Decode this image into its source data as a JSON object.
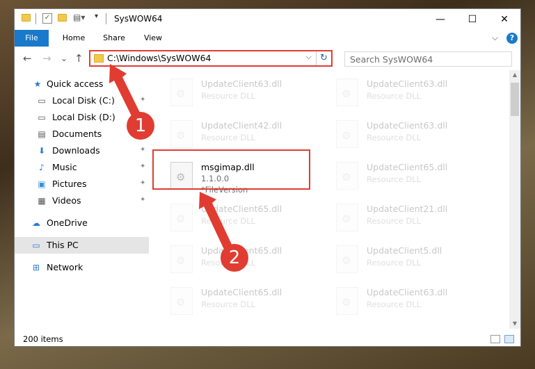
{
  "window": {
    "title": "SysWOW64",
    "minimize": "—",
    "maximize": "☐",
    "close": "✕"
  },
  "ribbon": {
    "tabs": [
      "File",
      "Home",
      "Share",
      "View"
    ],
    "collapse": "⌵",
    "help": "?"
  },
  "address": {
    "path": "C:\\Windows\\SysWOW64",
    "dropdown": "⌵",
    "refresh": "↻"
  },
  "search": {
    "placeholder": "Search SysWOW64"
  },
  "nav": {
    "back": "←",
    "forward": "→",
    "recent": "⌄",
    "up": "↑"
  },
  "sidebar": {
    "items": [
      {
        "label": "Quick access",
        "icon": "star-icon",
        "glyph": "★",
        "color": "#2b7cd3"
      },
      {
        "label": "Local Disk (C:)",
        "icon": "drive-icon",
        "glyph": "▭",
        "color": "#555555",
        "pinned": true
      },
      {
        "label": "Local Disk (D:)",
        "icon": "drive-icon",
        "glyph": "▭",
        "color": "#555555",
        "pinned": false
      },
      {
        "label": "Documents",
        "icon": "documents-icon",
        "glyph": "▤",
        "color": "#555555",
        "pinned": true
      },
      {
        "label": "Downloads",
        "icon": "download-icon",
        "glyph": "⬇",
        "color": "#2b7cd3",
        "pinned": true
      },
      {
        "label": "Music",
        "icon": "music-icon",
        "glyph": "♪",
        "color": "#2b7cd3",
        "pinned": true
      },
      {
        "label": "Pictures",
        "icon": "pictures-icon",
        "glyph": "▣",
        "color": "#3a8fd6",
        "pinned": true
      },
      {
        "label": "Videos",
        "icon": "videos-icon",
        "glyph": "▦",
        "color": "#555555",
        "pinned": true
      },
      {
        "label": "OneDrive",
        "icon": "cloud-icon",
        "glyph": "☁",
        "color": "#2b7cd3"
      },
      {
        "label": "This PC",
        "icon": "computer-icon",
        "glyph": "▭",
        "color": "#2b7cd3"
      },
      {
        "label": "Network",
        "icon": "network-icon",
        "glyph": "⊞",
        "color": "#2b7cd3"
      }
    ],
    "pin_glyph": "📌"
  },
  "files": [
    {
      "name": "UpdateClient63.dll",
      "desc": "Resource DLL"
    },
    {
      "name": "UpdateClient63.dll",
      "desc": "Resource DLL"
    },
    {
      "name": "UpdateClient42.dll",
      "desc": "Resource DLL"
    },
    {
      "name": "UpdateClient63.dll",
      "desc": "Resource DLL"
    },
    {
      "name": "msgimap.dll",
      "version": "1.1.0.0",
      "desc": "*FileVersion"
    },
    {
      "name": "UpdateClient65.dll",
      "desc": "Resource DLL"
    },
    {
      "name": "UpdateClient65.dll",
      "desc": "Resource DLL"
    },
    {
      "name": "UpdateClient21.dll",
      "desc": "Resource DLL"
    },
    {
      "name": "UpdateClient65.dll",
      "desc": "Resource DLL"
    },
    {
      "name": "UpdateClient5.dll",
      "desc": "Resource DLL"
    },
    {
      "name": "UpdateClient65.dll",
      "desc": "Resource DLL"
    },
    {
      "name": "UpdateClient63.dll",
      "desc": "Resource DLL"
    }
  ],
  "status": {
    "count": "200 items"
  },
  "callouts": [
    "1",
    "2"
  ],
  "colors": {
    "accent": "#1979ca",
    "highlight": "#e03c31"
  }
}
